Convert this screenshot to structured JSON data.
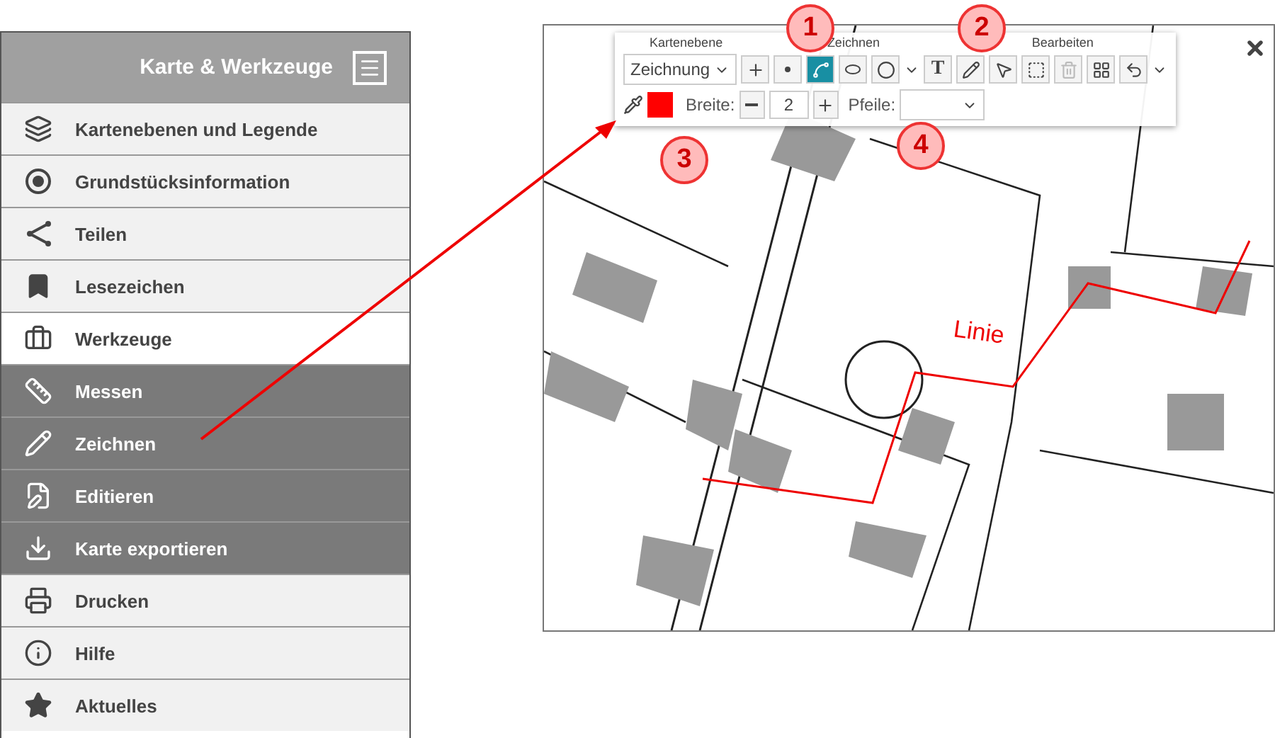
{
  "sidebar": {
    "title": "Karte & Werkzeuge",
    "items": [
      {
        "label": "Kartenebenen und Legende",
        "kind": "main",
        "selected": false
      },
      {
        "label": "Grundstücksinformation",
        "kind": "main",
        "selected": false
      },
      {
        "label": "Teilen",
        "kind": "main",
        "selected": false
      },
      {
        "label": "Lesezeichen",
        "kind": "main",
        "selected": false
      },
      {
        "label": "Werkzeuge",
        "kind": "main",
        "selected": true
      },
      {
        "label": "Messen",
        "kind": "sub",
        "selected": false
      },
      {
        "label": "Zeichnen",
        "kind": "sub",
        "selected": false
      },
      {
        "label": "Editieren",
        "kind": "sub",
        "selected": false
      },
      {
        "label": "Karte exportieren",
        "kind": "sub",
        "selected": false
      },
      {
        "label": "Drucken",
        "kind": "main",
        "selected": false
      },
      {
        "label": "Hilfe",
        "kind": "main",
        "selected": false
      },
      {
        "label": "Aktuelles",
        "kind": "main",
        "selected": false
      }
    ]
  },
  "toolbar": {
    "groups": [
      "Kartenebene",
      "Zeichnen",
      "Bearbeiten"
    ],
    "layer_select": {
      "value": "Zeichnung"
    },
    "tools": [
      {
        "kind": "add",
        "selected": false,
        "disabled": false
      },
      {
        "kind": "point",
        "selected": false,
        "disabled": false
      },
      {
        "kind": "line",
        "selected": true,
        "disabled": false
      },
      {
        "kind": "polygon",
        "selected": false,
        "disabled": false
      },
      {
        "kind": "circle",
        "selected": false,
        "disabled": false
      },
      {
        "kind": "text",
        "label": "T",
        "selected": false,
        "disabled": false
      },
      {
        "kind": "pen",
        "selected": false,
        "disabled": false
      },
      {
        "kind": "select",
        "selected": false,
        "disabled": false
      },
      {
        "kind": "vertices",
        "selected": false,
        "disabled": false
      },
      {
        "kind": "delete",
        "selected": false,
        "disabled": true
      },
      {
        "kind": "grid",
        "selected": false,
        "disabled": false
      },
      {
        "kind": "undo",
        "selected": false,
        "disabled": false
      }
    ],
    "width_label": "Breite:",
    "width_value": "2",
    "arrows_label": "Pfeile:"
  },
  "map": {
    "line_label": "Linie"
  },
  "callouts": [
    {
      "label": "1"
    },
    {
      "label": "2"
    },
    {
      "label": "3"
    },
    {
      "label": "4"
    }
  ]
}
